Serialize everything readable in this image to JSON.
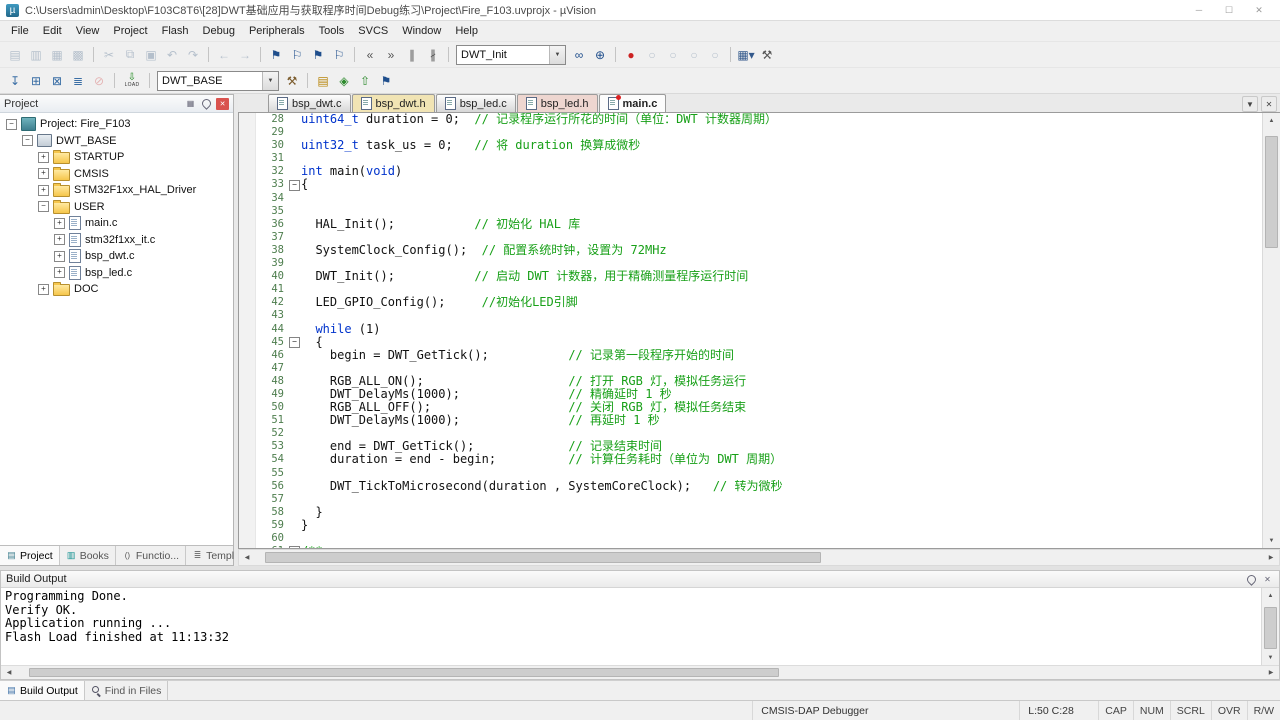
{
  "window": {
    "title": "C:\\Users\\admin\\Desktop\\F103C8T6\\[28]DWT基础应用与获取程序时间Debug练习\\Project\\Fire_F103.uvprojx - µVision",
    "controls": {
      "minimize": "─",
      "maximize": "☐",
      "close": "✕"
    }
  },
  "menu": {
    "items": [
      "File",
      "Edit",
      "View",
      "Project",
      "Flash",
      "Debug",
      "Peripherals",
      "Tools",
      "SVCS",
      "Window",
      "Help"
    ]
  },
  "toolbar_top": {
    "find_value": "DWT_Init",
    "items": [
      {
        "type": "icon",
        "name": "new-file-icon",
        "glyph": "▤",
        "faded": true
      },
      {
        "type": "icon",
        "name": "open-file-icon",
        "glyph": "▥",
        "faded": true
      },
      {
        "type": "icon",
        "name": "save-icon",
        "glyph": "▦",
        "faded": true
      },
      {
        "type": "icon",
        "name": "save-all-icon",
        "glyph": "▩",
        "faded": true
      },
      {
        "type": "sep"
      },
      {
        "type": "icon",
        "name": "cut-icon",
        "glyph": "✂",
        "faded": true
      },
      {
        "type": "icon",
        "name": "copy-icon",
        "glyph": "⧉",
        "faded": true
      },
      {
        "type": "icon",
        "name": "paste-icon",
        "glyph": "▣",
        "faded": true
      },
      {
        "type": "icon",
        "name": "undo-icon",
        "glyph": "↶",
        "faded": true
      },
      {
        "type": "icon",
        "name": "redo-icon",
        "glyph": "↷",
        "faded": true
      },
      {
        "type": "sep"
      },
      {
        "type": "icon",
        "name": "nav-back-icon",
        "glyph": "←",
        "faded": true
      },
      {
        "type": "icon",
        "name": "nav-forward-icon",
        "glyph": "→",
        "faded": true
      },
      {
        "type": "sep"
      },
      {
        "type": "icon",
        "name": "bookmark-toggle-icon",
        "glyph": "⚑",
        "color": "#1f4e8c"
      },
      {
        "type": "icon",
        "name": "bookmark-prev-icon",
        "glyph": "⚐",
        "color": "#1f4e8c"
      },
      {
        "type": "icon",
        "name": "bookmark-next-icon",
        "glyph": "⚑",
        "color": "#1f4e8c"
      },
      {
        "type": "icon",
        "name": "bookmark-clear-icon",
        "glyph": "⚐",
        "color": "#1f4e8c"
      },
      {
        "type": "sep"
      },
      {
        "type": "icon",
        "name": "indent-left-icon",
        "glyph": "«",
        "color": "#555555"
      },
      {
        "type": "icon",
        "name": "indent-right-icon",
        "glyph": "»",
        "color": "#555555"
      },
      {
        "type": "icon",
        "name": "comment-icon",
        "glyph": "∥",
        "color": "#555555"
      },
      {
        "type": "icon",
        "name": "uncomment-icon",
        "glyph": "∦",
        "color": "#555555"
      },
      {
        "type": "sep"
      },
      {
        "type": "combo",
        "name": "find-combo",
        "value": "DWT_Init",
        "width": 108
      },
      {
        "type": "icon",
        "name": "find-in-files-icon",
        "glyph": "∞",
        "color": "#1f4e8c"
      },
      {
        "type": "icon",
        "name": "incremental-find-icon",
        "glyph": "⊕",
        "color": "#1f4e8c"
      },
      {
        "type": "sep"
      },
      {
        "type": "icon",
        "name": "record-icon",
        "glyph": "●",
        "color": "#cc2222"
      },
      {
        "type": "icon",
        "name": "run-icon",
        "glyph": "○",
        "faded": true
      },
      {
        "type": "icon",
        "name": "stop-icon",
        "glyph": "○",
        "faded": true
      },
      {
        "type": "icon",
        "name": "step-icon",
        "glyph": "○",
        "faded": true
      },
      {
        "type": "icon",
        "name": "reset-icon",
        "glyph": "○",
        "faded": true
      },
      {
        "type": "sep"
      },
      {
        "type": "icon",
        "name": "debug-windows-icon",
        "glyph": "▦▾",
        "color": "#33598c"
      },
      {
        "type": "icon",
        "name": "configure-tools-icon",
        "glyph": "⚒",
        "color": "#555555"
      }
    ]
  },
  "toolbar_build": {
    "target_value": "DWT_BASE",
    "items": [
      {
        "type": "icon",
        "name": "translate-icon",
        "glyph": "↧",
        "color": "#3a6ea5"
      },
      {
        "type": "icon",
        "name": "build-icon",
        "glyph": "⊞",
        "color": "#3a6ea5"
      },
      {
        "type": "icon",
        "name": "rebuild-icon",
        "glyph": "⊠",
        "color": "#3a6ea5"
      },
      {
        "type": "icon",
        "name": "batch-build-icon",
        "glyph": "≣",
        "color": "#3a6ea5"
      },
      {
        "type": "icon",
        "name": "stop-build-icon",
        "glyph": "⊘",
        "color": "#cc3333",
        "faded": true
      },
      {
        "type": "sep"
      },
      {
        "type": "load",
        "name": "download-button",
        "label": "LOAD"
      },
      {
        "type": "sep"
      },
      {
        "type": "combo",
        "name": "target-combo",
        "value": "DWT_BASE",
        "width": 120
      },
      {
        "type": "icon",
        "name": "options-for-target-icon",
        "glyph": "⚒",
        "color": "#7a5a2a"
      },
      {
        "type": "sep"
      },
      {
        "type": "icon",
        "name": "file-extensions-icon",
        "glyph": "▤",
        "color": "#b8860b"
      },
      {
        "type": "icon",
        "name": "manage-rte-icon",
        "glyph": "◈",
        "color": "#2e8b2e"
      },
      {
        "type": "icon",
        "name": "update-target-icon",
        "glyph": "⇧",
        "color": "#2e8b2e"
      },
      {
        "type": "icon",
        "name": "flag-icon",
        "glyph": "⚑",
        "color": "#1f4e8c"
      }
    ]
  },
  "project_panel": {
    "title": "Project",
    "tree": [
      {
        "label": "Project: Fire_F103",
        "level": 0,
        "expander": "minus",
        "icon": "project"
      },
      {
        "label": "DWT_BASE",
        "level": 1,
        "expander": "minus",
        "icon": "target"
      },
      {
        "label": "STARTUP",
        "level": 2,
        "expander": "plus",
        "icon": "folder"
      },
      {
        "label": "CMSIS",
        "level": 2,
        "expander": "plus",
        "icon": "folder"
      },
      {
        "label": "STM32F1xx_HAL_Driver",
        "level": 2,
        "expander": "plus",
        "icon": "folder"
      },
      {
        "label": "USER",
        "level": 2,
        "expander": "minus",
        "icon": "folder"
      },
      {
        "label": "main.c",
        "level": 3,
        "expander": "plus",
        "icon": "file"
      },
      {
        "label": "stm32f1xx_it.c",
        "level": 3,
        "expander": "plus",
        "icon": "file"
      },
      {
        "label": "bsp_dwt.c",
        "level": 3,
        "expander": "plus",
        "icon": "file"
      },
      {
        "label": "bsp_led.c",
        "level": 3,
        "expander": "plus",
        "icon": "file"
      },
      {
        "label": "DOC",
        "level": 2,
        "expander": "plus",
        "icon": "folder"
      }
    ],
    "tabs": [
      {
        "label": "Project",
        "icon": "project",
        "active": true
      },
      {
        "label": "Books",
        "icon": "books"
      },
      {
        "label": "Functio...",
        "icon": "functions"
      },
      {
        "label": "Templat...",
        "icon": "templates"
      }
    ]
  },
  "editor": {
    "tabs": [
      {
        "label": "bsp_dwt.c",
        "name": "tab-bsp-dwt-c"
      },
      {
        "label": "bsp_dwt.h",
        "name": "tab-bsp-dwt-h",
        "tint": "#f1e4b4"
      },
      {
        "label": "bsp_led.c",
        "name": "tab-bsp-led-c"
      },
      {
        "label": "bsp_led.h",
        "name": "tab-bsp-led-h",
        "tint": "#eed6d0"
      },
      {
        "label": "main.c",
        "name": "tab-main-c",
        "active": true,
        "modified": true
      }
    ],
    "lines": [
      {
        "n": 28,
        "segs": [
          [
            "k",
            "uint64_t"
          ],
          [
            "p",
            " duration = 0;  "
          ],
          [
            "c",
            "// 记录程序运行所花的时间（单位：DWT 计数器周期）"
          ]
        ]
      },
      {
        "n": 29,
        "segs": []
      },
      {
        "n": 30,
        "segs": [
          [
            "k",
            "uint32_t"
          ],
          [
            "p",
            " task_us = 0;   "
          ],
          [
            "c",
            "// 将 duration 换算成微秒"
          ]
        ]
      },
      {
        "n": 31,
        "segs": []
      },
      {
        "n": 32,
        "segs": [
          [
            "k",
            "int"
          ],
          [
            "p",
            " main("
          ],
          [
            "k",
            "void"
          ],
          [
            "p",
            ")"
          ]
        ]
      },
      {
        "n": 33,
        "fold": true,
        "segs": [
          [
            "p",
            "{"
          ]
        ]
      },
      {
        "n": 34,
        "segs": []
      },
      {
        "n": 35,
        "segs": []
      },
      {
        "n": 36,
        "segs": [
          [
            "p",
            "  HAL_Init();           "
          ],
          [
            "c",
            "// 初始化 HAL 库"
          ]
        ]
      },
      {
        "n": 37,
        "segs": []
      },
      {
        "n": 38,
        "segs": [
          [
            "p",
            "  SystemClock_Config();  "
          ],
          [
            "c",
            "// 配置系统时钟，设置为 72MHz"
          ]
        ]
      },
      {
        "n": 39,
        "segs": []
      },
      {
        "n": 40,
        "segs": [
          [
            "p",
            "  DWT_Init();           "
          ],
          [
            "c",
            "// 启动 DWT 计数器，用于精确测量程序运行时间"
          ]
        ]
      },
      {
        "n": 41,
        "segs": []
      },
      {
        "n": 42,
        "segs": [
          [
            "p",
            "  LED_GPIO_Config();     "
          ],
          [
            "c",
            "//初始化LED引脚"
          ]
        ]
      },
      {
        "n": 43,
        "segs": []
      },
      {
        "n": 44,
        "segs": [
          [
            "p",
            "  "
          ],
          [
            "k",
            "while"
          ],
          [
            "p",
            " (1)"
          ]
        ]
      },
      {
        "n": 45,
        "fold": true,
        "segs": [
          [
            "p",
            "  {"
          ]
        ]
      },
      {
        "n": 46,
        "segs": [
          [
            "p",
            "    begin = DWT_GetTick();           "
          ],
          [
            "c",
            "// 记录第一段程序开始的时间"
          ]
        ]
      },
      {
        "n": 47,
        "segs": []
      },
      {
        "n": 48,
        "segs": [
          [
            "p",
            "    RGB_ALL_ON();                    "
          ],
          [
            "c",
            "// 打开 RGB 灯，模拟任务运行"
          ]
        ]
      },
      {
        "n": 49,
        "segs": [
          [
            "p",
            "    DWT_DelayMs(1000);               "
          ],
          [
            "c",
            "// 精确延时 1 秒"
          ]
        ]
      },
      {
        "n": 50,
        "segs": [
          [
            "p",
            "    RGB_ALL_OFF();                   "
          ],
          [
            "c",
            "// 关闭 RGB 灯，模拟任务结束"
          ]
        ]
      },
      {
        "n": 51,
        "segs": [
          [
            "p",
            "    DWT_DelayMs(1000);               "
          ],
          [
            "c",
            "// 再延时 1 秒"
          ]
        ]
      },
      {
        "n": 52,
        "segs": []
      },
      {
        "n": 53,
        "segs": [
          [
            "p",
            "    end = DWT_GetTick();             "
          ],
          [
            "c",
            "// 记录结束时间"
          ]
        ]
      },
      {
        "n": 54,
        "segs": [
          [
            "p",
            "    duration = end - begin;          "
          ],
          [
            "c",
            "// 计算任务耗时（单位为 DWT 周期）"
          ]
        ]
      },
      {
        "n": 55,
        "segs": []
      },
      {
        "n": 56,
        "segs": [
          [
            "p",
            "    DWT_TickToMicrosecond(duration , SystemCoreClock);   "
          ],
          [
            "c",
            "// 转为微秒"
          ]
        ]
      },
      {
        "n": 57,
        "segs": []
      },
      {
        "n": 58,
        "segs": [
          [
            "p",
            "  }"
          ]
        ]
      },
      {
        "n": 59,
        "segs": [
          [
            "p",
            "}"
          ]
        ]
      },
      {
        "n": 60,
        "segs": []
      },
      {
        "n": 61,
        "fold": true,
        "segs": [
          [
            "c",
            "/**"
          ]
        ]
      }
    ]
  },
  "build_output": {
    "title": "Build Output",
    "lines": [
      "Programming Done.",
      "Verify OK.",
      "Application running ...",
      "Flash Load finished at 11:13:32"
    ]
  },
  "bottom_tabs": [
    {
      "label": "Build Output",
      "icon": "build",
      "active": true
    },
    {
      "label": "Find in Files",
      "icon": "find"
    }
  ],
  "status": {
    "debugger": "CMSIS-DAP Debugger",
    "cursor": "L:50 C:28",
    "flags": [
      "CAP",
      "NUM",
      "SCRL",
      "OVR",
      "R/W"
    ]
  }
}
